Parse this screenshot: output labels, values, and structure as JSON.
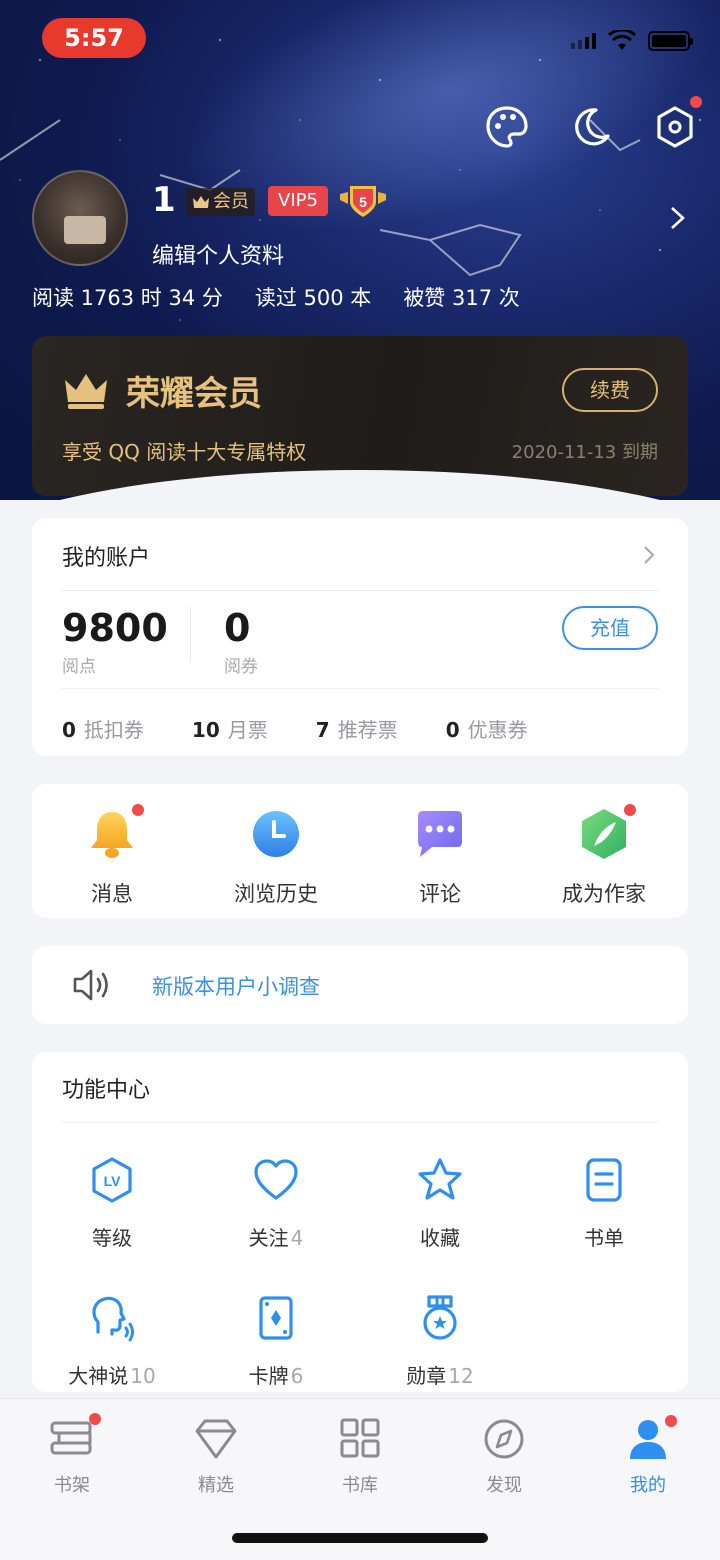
{
  "status_bar": {
    "time": "5:57"
  },
  "profile": {
    "username": "1",
    "member_badge": "会员",
    "vip_badge": "VIP5",
    "level": "5",
    "edit_label": "编辑个人资料",
    "stats": [
      "阅读 1763 时 34 分",
      "读过 500 本",
      "被赞 317 次"
    ]
  },
  "vip_card": {
    "title": "荣耀会员",
    "subtitle": "享受 QQ 阅读十大专属特权",
    "renew_label": "续费",
    "expire": "2020-11-13 到期"
  },
  "account": {
    "title": "我的账户",
    "balance1": {
      "value": "9800",
      "label": "阅点"
    },
    "balance2": {
      "value": "0",
      "label": "阅券"
    },
    "recharge_label": "充值",
    "tickets": [
      {
        "count": "0",
        "label": "抵扣券"
      },
      {
        "count": "10",
        "label": "月票"
      },
      {
        "count": "7",
        "label": "推荐票"
      },
      {
        "count": "0",
        "label": "优惠券"
      }
    ]
  },
  "shortcuts": [
    {
      "label": "消息",
      "icon": "bell-icon"
    },
    {
      "label": "浏览历史",
      "icon": "clock-icon"
    },
    {
      "label": "评论",
      "icon": "chat-icon"
    },
    {
      "label": "成为作家",
      "icon": "pen-icon"
    }
  ],
  "survey": {
    "text": "新版本用户小调查",
    "icon": "speaker-icon"
  },
  "functions": {
    "title": "功能中心",
    "items": [
      {
        "label": "等级",
        "count": ""
      },
      {
        "label": "关注",
        "count": "4"
      },
      {
        "label": "收藏",
        "count": ""
      },
      {
        "label": "书单",
        "count": ""
      },
      {
        "label": "大神说",
        "count": "10"
      },
      {
        "label": "卡牌",
        "count": "6"
      },
      {
        "label": "勋章",
        "count": "12"
      }
    ]
  },
  "tabs": [
    {
      "label": "书架",
      "icon": "bookshelf-icon"
    },
    {
      "label": "精选",
      "icon": "diamond-icon"
    },
    {
      "label": "书库",
      "icon": "grid-icon"
    },
    {
      "label": "发现",
      "icon": "compass-icon"
    },
    {
      "label": "我的",
      "icon": "user-icon"
    }
  ],
  "colors": {
    "accent": "#2f8ff0",
    "gold": "#e6c27e",
    "red": "#f24a4a"
  }
}
